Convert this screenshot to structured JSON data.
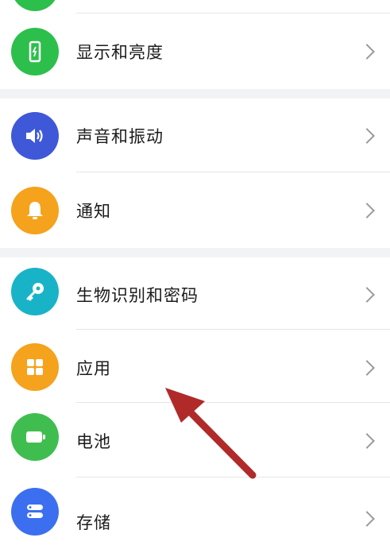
{
  "items": [
    {
      "label": "显示和亮度",
      "icon": "phone-display-icon",
      "color": "#2dbf4c"
    },
    {
      "label": "声音和振动",
      "icon": "speaker-icon",
      "color": "#3f58d8"
    },
    {
      "label": "通知",
      "icon": "bell-icon",
      "color": "#f5a21c"
    },
    {
      "label": "生物识别和密码",
      "icon": "key-icon",
      "color": "#19b3c8"
    },
    {
      "label": "应用",
      "icon": "apps-grid-icon",
      "color": "#f5a21c"
    },
    {
      "label": "电池",
      "icon": "battery-icon",
      "color": "#3fbe4f"
    },
    {
      "label": "存储",
      "icon": "storage-icon",
      "color": "#3b6ff0"
    }
  ],
  "colors": {
    "gap": "#f1f3f5",
    "arrow": "#b02a2a"
  }
}
